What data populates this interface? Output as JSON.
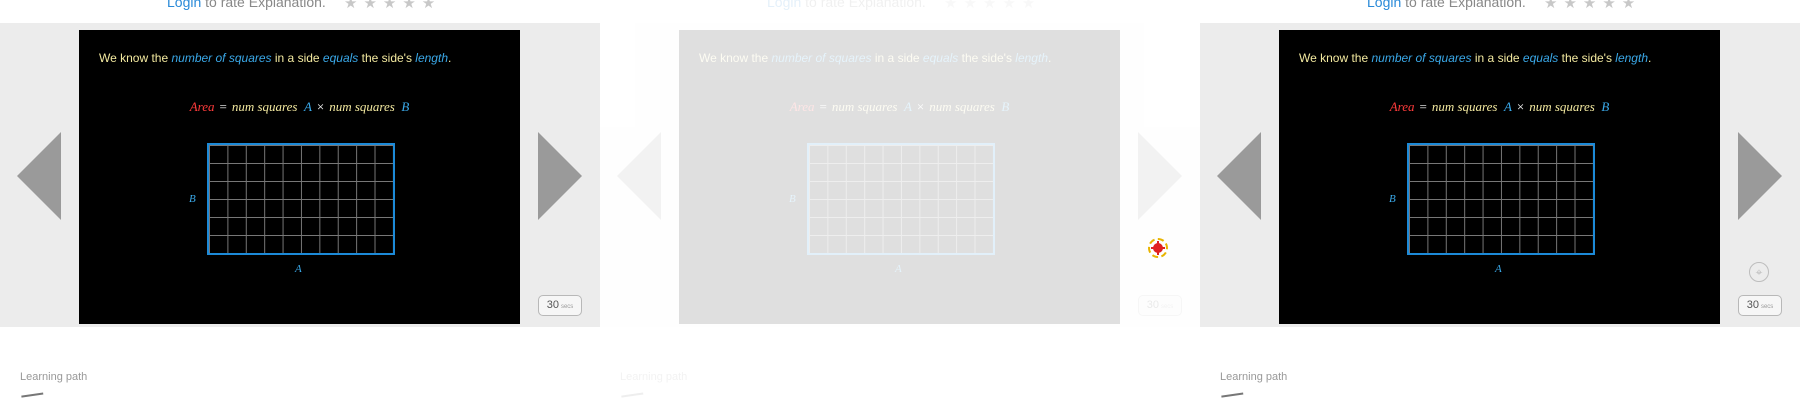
{
  "rating": {
    "login_label": "Login",
    "rate_text": " to rate Explanation.",
    "stars": "★★★★★"
  },
  "slide": {
    "text_parts": [
      "We know the ",
      "number of squares",
      " in a side ",
      "equals",
      " the side's ",
      "length",
      "."
    ],
    "formula": {
      "area": "Area",
      "equals": "=",
      "num_squares_1": "num squares",
      "a": "A",
      "times": "×",
      "num_squares_2": "num squares",
      "b": "B"
    },
    "label_a": "A",
    "label_b": "B"
  },
  "badge": {
    "value": "30",
    "unit": "secs"
  },
  "learning_path": {
    "label": "Learning path"
  },
  "colors": {
    "highlight": "#3aa8e8",
    "area": "#ff3b3b",
    "grid_border": "#1c8ad8",
    "text": "#f4eaa0"
  },
  "icons": {
    "prev": "chevron-left-icon",
    "next": "chevron-right-icon",
    "target": "crosshair-icon"
  }
}
